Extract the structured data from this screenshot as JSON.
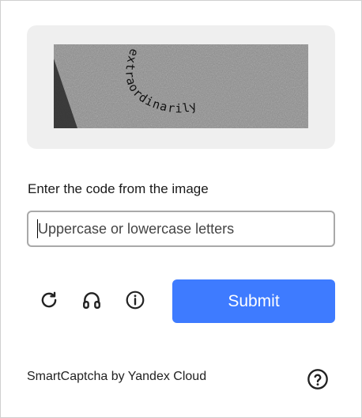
{
  "captcha": {
    "image_text": "extraordinarily"
  },
  "prompt": "Enter the code from the image",
  "input": {
    "value": "",
    "placeholder": "Uppercase or lowercase letters"
  },
  "controls": {
    "refresh_icon": "refresh-icon",
    "audio_icon": "headphones-icon",
    "info_icon": "info-icon",
    "submit_label": "Submit"
  },
  "footer": {
    "brand_text": "SmartCaptcha by Yandex Cloud",
    "help_icon": "question-icon"
  },
  "colors": {
    "accent": "#3e7bff",
    "panel": "#efefef",
    "icon": "#222222"
  }
}
